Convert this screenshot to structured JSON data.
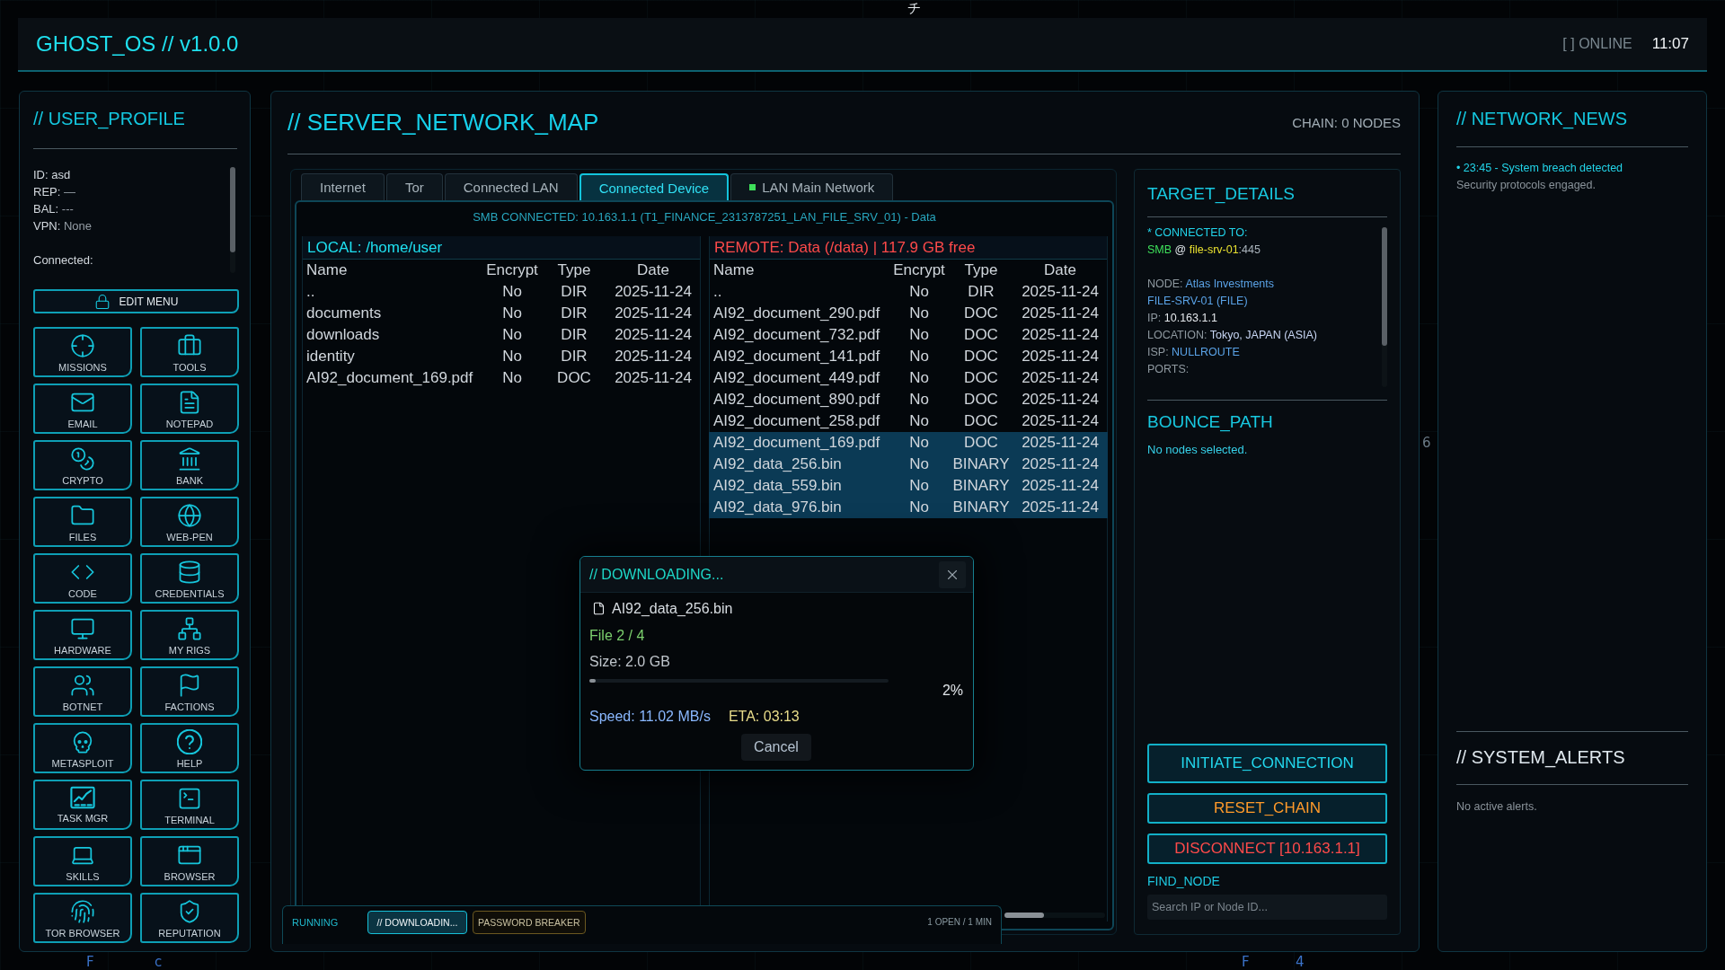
{
  "background_glyphs": [
    "チ",
    "F",
    "c",
    "6",
    "F",
    "4"
  ],
  "header": {
    "title": "GHOST_OS // v1.0.0",
    "status": "[ ] ONLINE",
    "clock": "11:07"
  },
  "user_profile": {
    "title": "// USER_PROFILE",
    "info": [
      {
        "field": "ID:",
        "value": "asd",
        "muted": false
      },
      {
        "field": "REP:",
        "value": "—",
        "muted": true
      },
      {
        "field": "BAL:",
        "value": "---",
        "muted": true
      },
      {
        "field": "VPN:",
        "value": "None",
        "muted": true
      }
    ],
    "connected_label": "Connected:",
    "edit_button": "EDIT MENU",
    "apps": [
      "MISSIONS",
      "TOOLS",
      "EMAIL",
      "NOTEPAD",
      "CRYPTO",
      "BANK",
      "FILES",
      "WEB-PEN",
      "CODE",
      "CREDENTIALS",
      "HARDWARE",
      "MY RIGS",
      "BOTNET",
      "FACTIONS",
      "METASPLOIT",
      "HELP",
      "TASK MGR",
      "TERMINAL",
      "SKILLS",
      "BROWSER",
      "TOR BROWSER",
      "REPUTATION"
    ]
  },
  "network_map": {
    "title": "// SERVER_NETWORK_MAP",
    "chain": "CHAIN: 0 NODES",
    "tabs": [
      {
        "label": "Internet",
        "selected": false,
        "indicator": false
      },
      {
        "label": "Tor",
        "selected": false,
        "indicator": false
      },
      {
        "label": "Connected LAN",
        "selected": false,
        "indicator": false
      },
      {
        "label": "Connected Device",
        "selected": true,
        "indicator": false
      },
      {
        "label": "LAN Main Network",
        "selected": false,
        "indicator": true
      }
    ]
  },
  "file_transfer": {
    "banner": "SMB CONNECTED: 10.163.1.1 (T1_FINANCE_2313787251_LAN_FILE_SRV_01) - Data",
    "panes": [
      {
        "kind": "local",
        "path": "LOCAL: /home/user",
        "columns": [
          "Name",
          "Encrypt",
          "Type",
          "Date"
        ],
        "rows": [
          {
            "cells": [
              "..",
              "No",
              "DIR",
              "2025-11-24"
            ],
            "selected": false
          },
          {
            "cells": [
              "documents",
              "No",
              "DIR",
              "2025-11-24"
            ],
            "selected": false
          },
          {
            "cells": [
              "downloads",
              "No",
              "DIR",
              "2025-11-24"
            ],
            "selected": false
          },
          {
            "cells": [
              "identity",
              "No",
              "DIR",
              "2025-11-24"
            ],
            "selected": false
          },
          {
            "cells": [
              "AI92_document_169.pdf",
              "No",
              "DOC",
              "2025-11-24"
            ],
            "selected": false
          }
        ]
      },
      {
        "kind": "remote",
        "path": "REMOTE: Data (/data) | 117.9 GB free",
        "columns": [
          "Name",
          "Encrypt",
          "Type",
          "Date"
        ],
        "rows": [
          {
            "cells": [
              "..",
              "No",
              "DIR",
              "2025-11-24"
            ],
            "selected": false
          },
          {
            "cells": [
              "AI92_document_290.pdf",
              "No",
              "DOC",
              "2025-11-24"
            ],
            "selected": false
          },
          {
            "cells": [
              "AI92_document_732.pdf",
              "No",
              "DOC",
              "2025-11-24"
            ],
            "selected": false
          },
          {
            "cells": [
              "AI92_document_141.pdf",
              "No",
              "DOC",
              "2025-11-24"
            ],
            "selected": false
          },
          {
            "cells": [
              "AI92_document_449.pdf",
              "No",
              "DOC",
              "2025-11-24"
            ],
            "selected": false
          },
          {
            "cells": [
              "AI92_document_890.pdf",
              "No",
              "DOC",
              "2025-11-24"
            ],
            "selected": false
          },
          {
            "cells": [
              "AI92_document_258.pdf",
              "No",
              "DOC",
              "2025-11-24"
            ],
            "selected": false
          },
          {
            "cells": [
              "AI92_document_169.pdf",
              "No",
              "DOC",
              "2025-11-24"
            ],
            "selected": true
          },
          {
            "cells": [
              "AI92_data_256.bin",
              "No",
              "BINARY",
              "2025-11-24"
            ],
            "selected": true
          },
          {
            "cells": [
              "AI92_data_559.bin",
              "No",
              "BINARY",
              "2025-11-24"
            ],
            "selected": true
          },
          {
            "cells": [
              "AI92_data_976.bin",
              "No",
              "BINARY",
              "2025-11-24"
            ],
            "selected": true
          }
        ]
      }
    ]
  },
  "download_dialog": {
    "title": "// DOWNLOADING...",
    "file": "AI92_data_256.bin",
    "file_count": "File 2 / 4",
    "size": "Size: 2.0 GB",
    "progress": {
      "level": 0.02,
      "reading": "2%"
    },
    "speed": "Speed: 11.02 MB/s",
    "eta": "ETA: 03:13",
    "cancel": "Cancel"
  },
  "taskbar": {
    "label": "RUNNING",
    "tasks": [
      {
        "label": "// DOWNLOADIN...",
        "selected": true
      },
      {
        "label": "PASSWORD BREAKER",
        "selected": false
      }
    ],
    "summary": "1 OPEN / 1 MIN"
  },
  "target_details": {
    "title": "TARGET_DETAILS",
    "connected_label": "* CONNECTED TO:",
    "connection": [
      {
        "text": "SMB",
        "kind": "protocol"
      },
      {
        "text": " @ ",
        "kind": "plain"
      },
      {
        "text": "file-srv-01",
        "kind": "host"
      },
      {
        "text": ":445",
        "kind": "port"
      }
    ],
    "fields": [
      {
        "label": "NODE:",
        "value": "Atlas Investments",
        "kind": "link"
      },
      {
        "value": "FILE-SRV-01 (FILE)",
        "kind": "link"
      },
      {
        "label": "IP:",
        "value": "10.163.1.1",
        "kind": "plain"
      },
      {
        "label": "LOCATION:",
        "value": "Tokyo, JAPAN (ASIA)",
        "kind": "place"
      },
      {
        "label": "ISP:",
        "value": "NULLROUTE",
        "kind": "link"
      },
      {
        "label": "PORTS:"
      }
    ]
  },
  "bounce_path": {
    "title": "BOUNCE_PATH",
    "empty": "No nodes selected."
  },
  "actions": [
    {
      "label": "INITIATE_CONNECTION",
      "kind": "primary"
    },
    {
      "label": "RESET_CHAIN",
      "kind": "warning"
    },
    {
      "label": "DISCONNECT [10.163.1.1]",
      "kind": "danger"
    }
  ],
  "find_node": {
    "label": "FIND_NODE",
    "placeholder": "Search IP or Node ID..."
  },
  "network_news": {
    "title": "// NETWORK_NEWS",
    "items": [
      {
        "headline": "• 23:45 - System breach detected",
        "body": "Security protocols engaged."
      }
    ]
  },
  "system_alerts": {
    "title": "// SYSTEM_ALERTS",
    "empty": "No active alerts."
  }
}
